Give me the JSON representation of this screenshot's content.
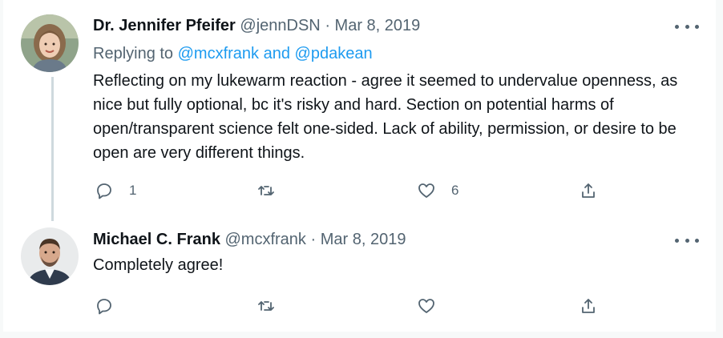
{
  "tweets": [
    {
      "display_name": "Dr. Jennifer Pfeifer",
      "handle": "@jennDSN",
      "separator": "·",
      "date": "Mar 8, 2019",
      "replying_prefix": "Replying to",
      "replying_mentions": "@mcxfrank and @pdakean",
      "text": "Reflecting on my lukewarm reaction - agree it seemed to undervalue openness, as nice but fully optional, bc it's risky and hard. Section on potential harms of open/transparent science felt one-sided. Lack of ability, permission, or desire to be open are very different things.",
      "reply_count": "1",
      "retweet_count": "",
      "like_count": "6"
    },
    {
      "display_name": "Michael C. Frank",
      "handle": "@mcxfrank",
      "separator": "·",
      "date": "Mar 8, 2019",
      "text": "Completely agree!",
      "reply_count": "",
      "retweet_count": "",
      "like_count": ""
    }
  ],
  "icons": {
    "reply": "reply-icon",
    "retweet": "retweet-icon",
    "like": "heart-icon",
    "share": "share-icon",
    "more": "more-icon"
  },
  "colors": {
    "link": "#1d9bf0",
    "muted": "#536471",
    "text": "#0f1419"
  }
}
